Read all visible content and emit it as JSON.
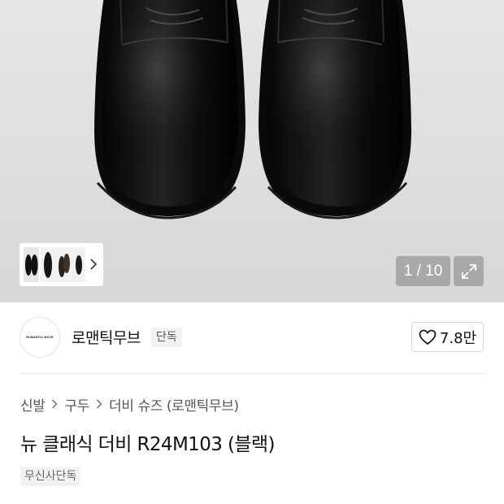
{
  "gallery": {
    "counter": "1 / 10",
    "current_index": 1,
    "total": 10
  },
  "brand": {
    "name": "로맨틱무브",
    "badge": "단독",
    "logo_text": "ROMANTIC MOVE"
  },
  "likes": {
    "count": "7.8만"
  },
  "breadcrumb": [
    "신발",
    "구두",
    "더비 슈즈 (로맨틱무브)"
  ],
  "product": {
    "title": "뉴 클래식 더비 R24M103 (블랙)",
    "badge": "무신사단독"
  },
  "colors": {
    "text_primary": "#111111",
    "text_secondary": "#555555",
    "badge_bg": "#f2f2f2",
    "border": "#d9d9d9"
  },
  "icons": {
    "thumb_arrow": "chevron-right-icon",
    "expand": "expand-icon",
    "like": "heart-icon",
    "breadcrumb_separator": "chevron-right-icon"
  }
}
